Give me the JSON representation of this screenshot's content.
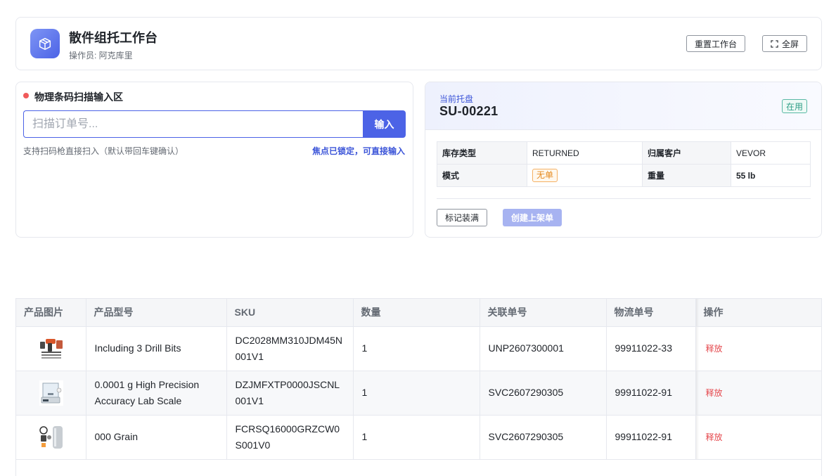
{
  "header": {
    "title": "散件组托工作台",
    "operator": "操作员: 阿克库里",
    "reset_label": "重置工作台",
    "fullscreen_label": "全屏",
    "logo_icon": "package-icon",
    "accent_color": "#4c63e6"
  },
  "scan": {
    "title": "物理条码扫描输入区",
    "placeholder": "扫描订单号...",
    "value": "",
    "submit_label": "输入",
    "hint": "支持扫码枪直接扫入（默认带回车键确认）",
    "focus_status": "焦点已锁定，可直接输入"
  },
  "pallet": {
    "label": "当前托盘",
    "id": "SU-00221",
    "status": "在用",
    "info": {
      "stock_type_label": "库存类型",
      "stock_type": "RETURNED",
      "customer_label": "归属客户",
      "customer": "VEVOR",
      "mode_label": "模式",
      "mode": "无单",
      "weight_label": "重量",
      "weight": "55 lb"
    },
    "mark_full_label": "标记装满",
    "create_putaway_label": "创建上架单"
  },
  "table": {
    "columns": [
      "产品图片",
      "产品型号",
      "SKU",
      "数量",
      "关联单号",
      "物流单号",
      "操作"
    ],
    "rows": [
      {
        "image_icon": "drill-kit-image",
        "model": "Including 3 Drill Bits",
        "sku": "DC2028MM310JDM45N001V1",
        "qty": "1",
        "ref_no": "UNP2607300001",
        "tracking_no": "99911022-33",
        "action": "释放"
      },
      {
        "image_icon": "lab-scale-image",
        "model": "0.0001 g High Precision Accuracy Lab Scale",
        "sku": "DZJMFXTP0000JSCNL001V1",
        "qty": "1",
        "ref_no": "SVC2607290305",
        "tracking_no": "99911022-91",
        "action": "释放"
      },
      {
        "image_icon": "grain-mill-image",
        "model": "000 Grain",
        "sku": "FCRSQ16000GRZCW0S001V0",
        "qty": "1",
        "ref_no": "SVC2607290305",
        "tracking_no": "99911022-91",
        "action": "释放"
      }
    ]
  }
}
